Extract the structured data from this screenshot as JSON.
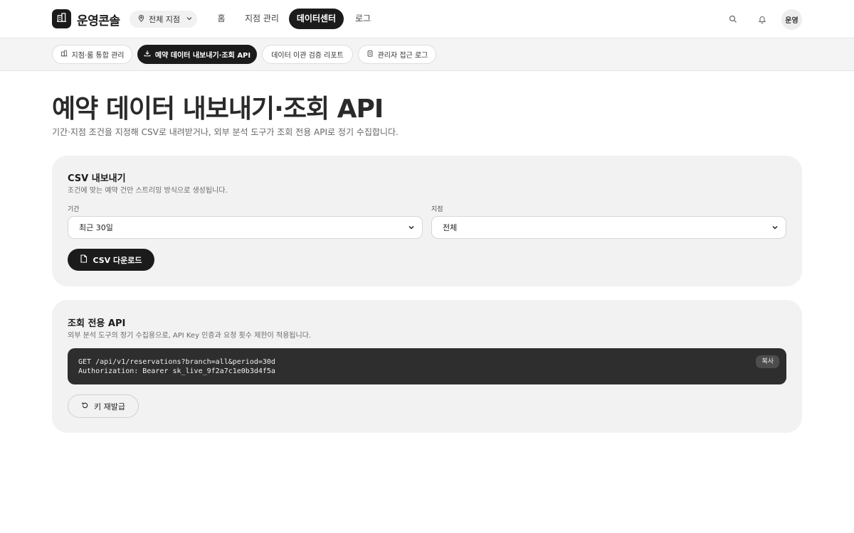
{
  "header": {
    "brand": "운영콘솔",
    "branch_selector": "전체 지점",
    "nav": {
      "home": "홈",
      "branch_mgmt": "지점 관리",
      "data_center": "데이터센터",
      "log": "로그"
    },
    "user_avatar": "운영"
  },
  "subtabs": {
    "tab1": "지점·룸 통합 관리",
    "tab2": "예약 데이터 내보내기·조회 API",
    "tab3": "데이터 이관 검증 리포트",
    "tab4": "관리자 접근 로그"
  },
  "page": {
    "title": "예약 데이터 내보내기·조회 API",
    "subtitle": "기간·지점 조건을 지정해 CSV로 내려받거나, 외부 분석 도구가 조회 전용 API로 정기 수집합니다."
  },
  "csv_card": {
    "title": "CSV 내보내기",
    "desc": "조건에 맞는 예약 건만 스트리밍 방식으로 생성됩니다.",
    "period_label": "기간",
    "period_value": "최근 30일",
    "branch_label": "지점",
    "branch_value": "전체",
    "download_button": "CSV 다운로드"
  },
  "api_card": {
    "title": "조회 전용 API",
    "desc": "외부 분석 도구의 정기 수집용으로, API Key 인증과 요청 횟수 제한이 적용됩니다.",
    "code_line1": "GET /api/v1/reservations?branch=all&period=30d",
    "code_line2": "Authorization: Bearer sk_live_9f2a7c1e0b3d4f5a",
    "copy_button": "복사",
    "reissue_button": "키 재발급"
  },
  "colors": {
    "accent": "#1b1b1b",
    "card_bg": "#f2f2f2",
    "code_bg": "#2e2e2e"
  },
  "icons": {
    "logo": "building-icon",
    "branch": "location-pin-icon",
    "search": "search-icon",
    "bell": "bell-icon",
    "download": "download-icon",
    "csv_file": "csv-file-icon",
    "refresh": "refresh-icon"
  }
}
